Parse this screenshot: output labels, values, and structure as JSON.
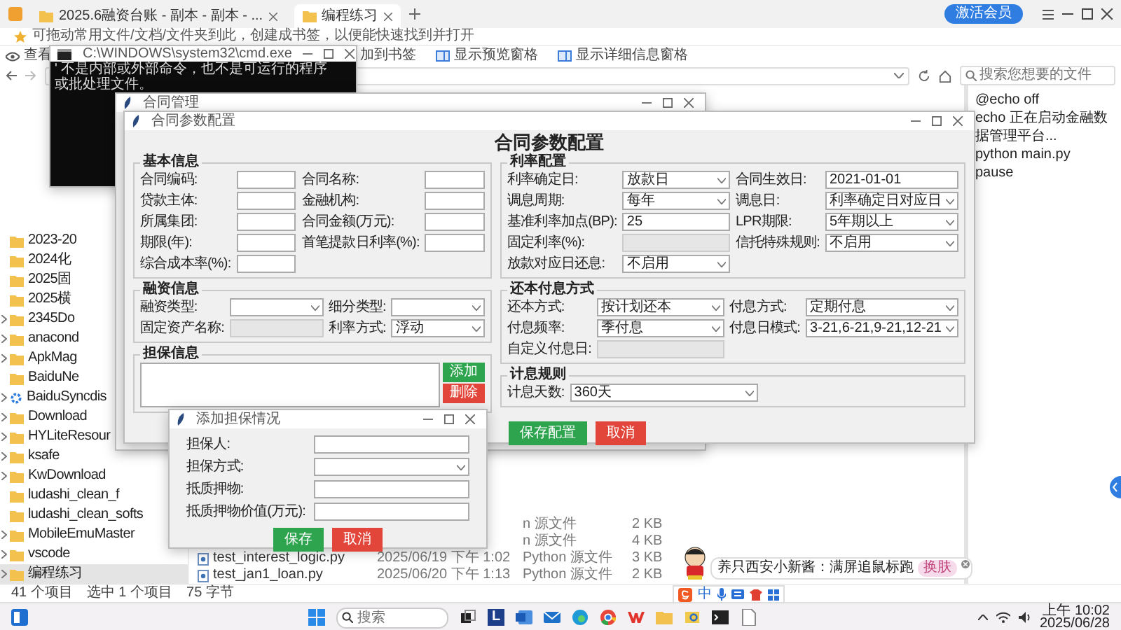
{
  "explorer": {
    "tabs": [
      {
        "label": "2025.6融资台账 - 副本 - 副本 - ...",
        "selected": false
      },
      {
        "label": "编程练习",
        "selected": true
      }
    ],
    "member_button": "激活会员",
    "bookmark_hint": "可拖动常用文件/文档/文件夹到此，创建成书签，以便能快速找到并打开",
    "toolbar": [
      {
        "label": "查看",
        "kind": "view"
      },
      {
        "label": "加到书签",
        "kind": "bookmark"
      },
      {
        "label": "显示预览窗格",
        "kind": "pane"
      },
      {
        "label": "显示详细信息窗格",
        "kind": "pane"
      }
    ],
    "search": {
      "placeholder": "搜索您想要的文件"
    },
    "sidebar": [
      {
        "name": "2023-20",
        "kind": "folder",
        "expandable": false,
        "selected": false
      },
      {
        "name": "2024化",
        "kind": "folder",
        "expandable": false,
        "selected": false
      },
      {
        "name": "2025固",
        "kind": "folder",
        "expandable": false,
        "selected": false
      },
      {
        "name": "2025横",
        "kind": "folder",
        "expandable": false,
        "selected": false
      },
      {
        "name": "2345Do",
        "kind": "folder",
        "expandable": true,
        "selected": false
      },
      {
        "name": "anacond",
        "kind": "folder",
        "expandable": true,
        "selected": false
      },
      {
        "name": "ApkMag",
        "kind": "folder",
        "expandable": true,
        "selected": false
      },
      {
        "name": "BaiduNe",
        "kind": "folder",
        "expandable": false,
        "selected": false
      },
      {
        "name": "BaiduSyncdis",
        "kind": "sync",
        "expandable": true,
        "selected": false
      },
      {
        "name": "Download",
        "kind": "folder",
        "expandable": true,
        "selected": false
      },
      {
        "name": "HYLiteResour",
        "kind": "folder",
        "expandable": true,
        "selected": false
      },
      {
        "name": "ksafe",
        "kind": "folder",
        "expandable": true,
        "selected": false
      },
      {
        "name": "KwDownload",
        "kind": "folder",
        "expandable": true,
        "selected": false
      },
      {
        "name": "ludashi_clean_f",
        "kind": "folder",
        "expandable": false,
        "selected": false
      },
      {
        "name": "ludashi_clean_softs",
        "kind": "folder",
        "expandable": false,
        "selected": false
      },
      {
        "name": "MobileEmuMaster",
        "kind": "folder",
        "expandable": true,
        "selected": false
      },
      {
        "name": "vscode",
        "kind": "folder",
        "expandable": true,
        "selected": false
      },
      {
        "name": "编程练习",
        "kind": "folder",
        "expandable": true,
        "selected": true
      }
    ],
    "files": [
      {
        "type": "n 源文件",
        "size": "2 KB"
      },
      {
        "type": "n 源文件",
        "size": "4 KB"
      },
      {
        "name": "test_interest_logic.py",
        "date": "2025/06/19 下午 1:02",
        "type": "Python 源文件",
        "size": "3 KB"
      },
      {
        "name": "test_jan1_loan.py",
        "date": "2025/06/20 下午 1:13",
        "type": "Python 源文件",
        "size": "2 KB"
      }
    ],
    "status": [
      "41 个项目",
      "选中 1 个项目",
      "75 字节"
    ],
    "preview_lines": [
      "@echo off",
      "echo 正在启动金融数据管理平台...",
      "python main.py",
      "pause"
    ]
  },
  "cmd_window": {
    "title": "C:\\WINDOWS\\system32\\cmd.exe",
    "lines": [
      "' 不是内部或外部命令，也不是可运行的程序",
      "或批处理文件。"
    ]
  },
  "manager_window": {
    "title": "合同管理"
  },
  "config_window": {
    "title": "合同参数配置",
    "heading": "合同参数配置",
    "left_sections": [
      {
        "title": "基本信息",
        "kind": "form",
        "fields": [
          {
            "label": "合同编码:",
            "kind": "input",
            "disabled": false
          },
          {
            "label": "合同名称:",
            "kind": "input",
            "disabled": false
          },
          {
            "label": "贷款主体:",
            "kind": "input",
            "disabled": false
          },
          {
            "label": "金融机构:",
            "kind": "input",
            "disabled": false
          },
          {
            "label": "所属集团:",
            "kind": "input",
            "disabled": false
          },
          {
            "label": "合同金额(万元):",
            "kind": "input",
            "disabled": false
          },
          {
            "label": "期限(年):",
            "kind": "input",
            "disabled": false
          },
          {
            "label": "首笔提款日利率(%):",
            "kind": "input",
            "disabled": false
          },
          {
            "label": "综合成本率(%):",
            "kind": "input",
            "disabled": false
          }
        ]
      },
      {
        "title": "融资信息",
        "kind": "form",
        "fields": [
          {
            "label": "融资类型:",
            "kind": "select",
            "disabled": false
          },
          {
            "label": "细分类型:",
            "kind": "select",
            "disabled": false
          },
          {
            "label": "固定资产名称:",
            "kind": "input",
            "disabled": true
          },
          {
            "label": "利率方式:",
            "kind": "select",
            "disabled": false,
            "value": "浮动"
          }
        ]
      },
      {
        "title": "担保信息",
        "kind": "list",
        "buttons": [
          {
            "label": "添加",
            "kind": "add"
          },
          {
            "label": "删除",
            "kind": "remove"
          }
        ]
      }
    ],
    "right_sections": [
      {
        "title": "利率配置",
        "kind": "form",
        "fields": [
          {
            "label": "利率确定日:",
            "kind": "select",
            "disabled": false,
            "value": "放款日"
          },
          {
            "label": "合同生效日:",
            "kind": "input",
            "disabled": false,
            "value": "2021-01-01"
          },
          {
            "label": "调息周期:",
            "kind": "select",
            "disabled": false,
            "value": "每年"
          },
          {
            "label": "调息日:",
            "kind": "select",
            "disabled": false,
            "value": "利率确定日对应日"
          },
          {
            "label": "基准利率加点(BP):",
            "kind": "input",
            "disabled": false,
            "value": "25"
          },
          {
            "label": "LPR期限:",
            "kind": "select",
            "disabled": false,
            "value": "5年期以上"
          },
          {
            "label": "固定利率(%):",
            "kind": "input",
            "disabled": true
          },
          {
            "label": "信托特殊规则:",
            "kind": "select",
            "disabled": false,
            "value": "不启用"
          },
          {
            "label": "放款对应日还息:",
            "kind": "select",
            "disabled": false,
            "value": "不启用"
          }
        ]
      },
      {
        "title": "还本付息方式",
        "kind": "form",
        "fields": [
          {
            "label": "还本方式:",
            "kind": "select",
            "disabled": false,
            "value": "按计划还本"
          },
          {
            "label": "付息方式:",
            "kind": "select",
            "disabled": false,
            "value": "定期付息"
          },
          {
            "label": "付息频率:",
            "kind": "select",
            "disabled": false,
            "value": "季付息"
          },
          {
            "label": "付息日模式:",
            "kind": "select",
            "disabled": false,
            "value": "3-21,6-21,9-21,12-21"
          },
          {
            "label": "自定义付息日:",
            "kind": "input",
            "disabled": true
          }
        ]
      },
      {
        "title": "计息规则",
        "kind": "form",
        "fields": [
          {
            "label": "计息天数:",
            "kind": "select",
            "disabled": false,
            "value": "360天"
          }
        ]
      }
    ],
    "buttons": [
      {
        "label": "保存配置",
        "kind": "primary"
      },
      {
        "label": "取消",
        "kind": "danger"
      }
    ]
  },
  "guarantee_dialog": {
    "title": "添加担保情况",
    "fields": [
      {
        "label": "担保人:",
        "kind": "input"
      },
      {
        "label": "担保方式:",
        "kind": "select"
      },
      {
        "label": "抵质押物:",
        "kind": "input"
      },
      {
        "label": "抵质押物价值(万元):",
        "kind": "input"
      }
    ],
    "buttons": [
      {
        "label": "保存",
        "kind": "primary"
      },
      {
        "label": "取消",
        "kind": "danger"
      }
    ]
  },
  "desk_pet": {
    "bubble": "养只西安小新酱：满屏追鼠标跑",
    "badge": "换肤"
  },
  "ime_toolbar": {
    "mode": "中"
  },
  "taskbar": {
    "search_placeholder": "搜索",
    "apps": [
      {
        "kind": "task-view"
      },
      {
        "kind": "letter-tile",
        "label": "L"
      },
      {
        "kind": "word"
      },
      {
        "kind": "mail"
      },
      {
        "kind": "edge"
      },
      {
        "kind": "chrome"
      },
      {
        "kind": "wps"
      },
      {
        "kind": "folder"
      },
      {
        "kind": "photos"
      },
      {
        "kind": "terminal"
      },
      {
        "kind": "document"
      }
    ],
    "time": "上午 10:02",
    "date": "2025/06/28"
  }
}
